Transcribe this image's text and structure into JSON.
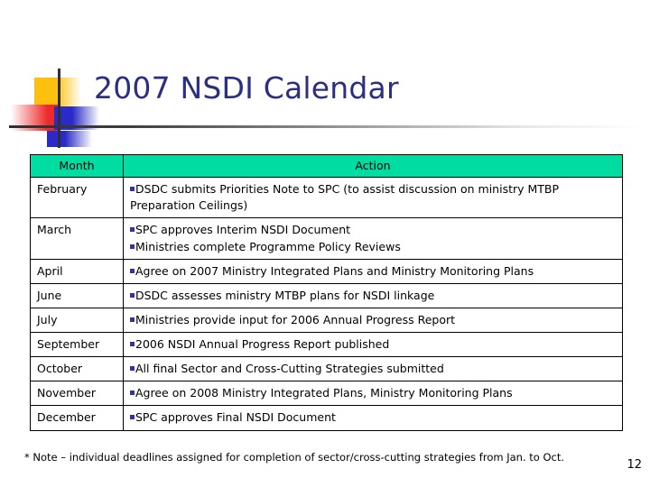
{
  "slide": {
    "title": "2007 NSDI Calendar",
    "title_color": "#2b2f80",
    "background_color": "#ffffff",
    "page_number": "12",
    "footnote": "* Note – individual deadlines assigned for completion of sector/cross-cutting strategies from Jan. to Oct."
  },
  "decoration": {
    "yellow_color": "#fdc00e",
    "red_color": "#ee2a2a",
    "blue_color": "#2a2bc7",
    "rule_color": "#2f2f33"
  },
  "table": {
    "header_background": "#00dca2",
    "bullet_color": "#33339c",
    "border_color": "#000000",
    "columns": [
      "Month",
      "Action"
    ],
    "rows": [
      {
        "month": "February",
        "actions": [
          "DSDC submits Priorities Note to SPC (to assist discussion on ministry MTBP Preparation Ceilings)"
        ]
      },
      {
        "month": "March",
        "actions": [
          "SPC approves Interim NSDI Document",
          "Ministries complete Programme Policy Reviews"
        ]
      },
      {
        "month": "April",
        "actions": [
          "Agree on 2007 Ministry Integrated Plans and Ministry Monitoring Plans"
        ]
      },
      {
        "month": "June",
        "actions": [
          "DSDC assesses ministry MTBP plans for NSDI linkage"
        ]
      },
      {
        "month": "July",
        "actions": [
          "Ministries provide input for 2006 Annual Progress Report"
        ]
      },
      {
        "month": "September",
        "actions": [
          "2006 NSDI Annual Progress Report published"
        ]
      },
      {
        "month": "October",
        "actions": [
          "All final Sector and Cross-Cutting Strategies submitted"
        ]
      },
      {
        "month": "November",
        "actions": [
          "Agree on 2008 Ministry Integrated Plans, Ministry Monitoring Plans"
        ]
      },
      {
        "month": "December",
        "actions": [
          "SPC approves Final NSDI Document"
        ]
      }
    ]
  }
}
